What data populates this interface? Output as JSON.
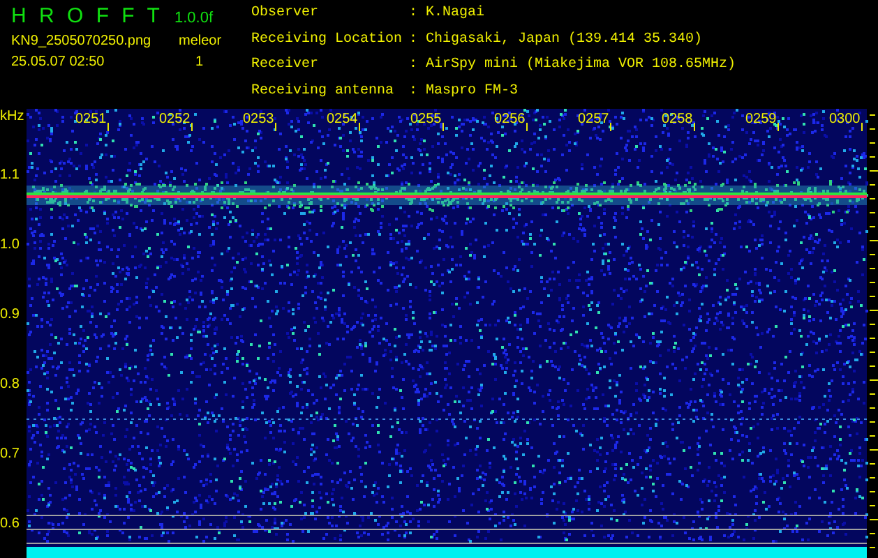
{
  "header": {
    "title": "H R O F F T",
    "version": "1.0.0f",
    "filename": "KN9_2505070250.png",
    "mode": "meleor",
    "datetime": "25.05.07 02:50",
    "count": "1"
  },
  "info": [
    {
      "label": "Observer",
      "sep": ":",
      "value": "K.Nagai"
    },
    {
      "label": "Receiving Location",
      "sep": ":",
      "value": "Chigasaki, Japan (139.414 35.340)"
    },
    {
      "label": "Receiver",
      "sep": ":",
      "value": "AirSpy mini (Miakejima VOR 108.65MHz)"
    },
    {
      "label": "Receiving antenna",
      "sep": ":",
      "value": "Maspro FM-3"
    }
  ],
  "waterfall": {
    "y_unit": "kHz",
    "y_labels": [
      "1.1",
      "1.0",
      "0.9",
      "0.8",
      "0.7",
      "0.6"
    ],
    "time_labels": [
      "0251",
      "0252",
      "0253",
      "0254",
      "0255",
      "0256",
      "0257",
      "0258",
      "0259",
      "0300"
    ]
  }
}
